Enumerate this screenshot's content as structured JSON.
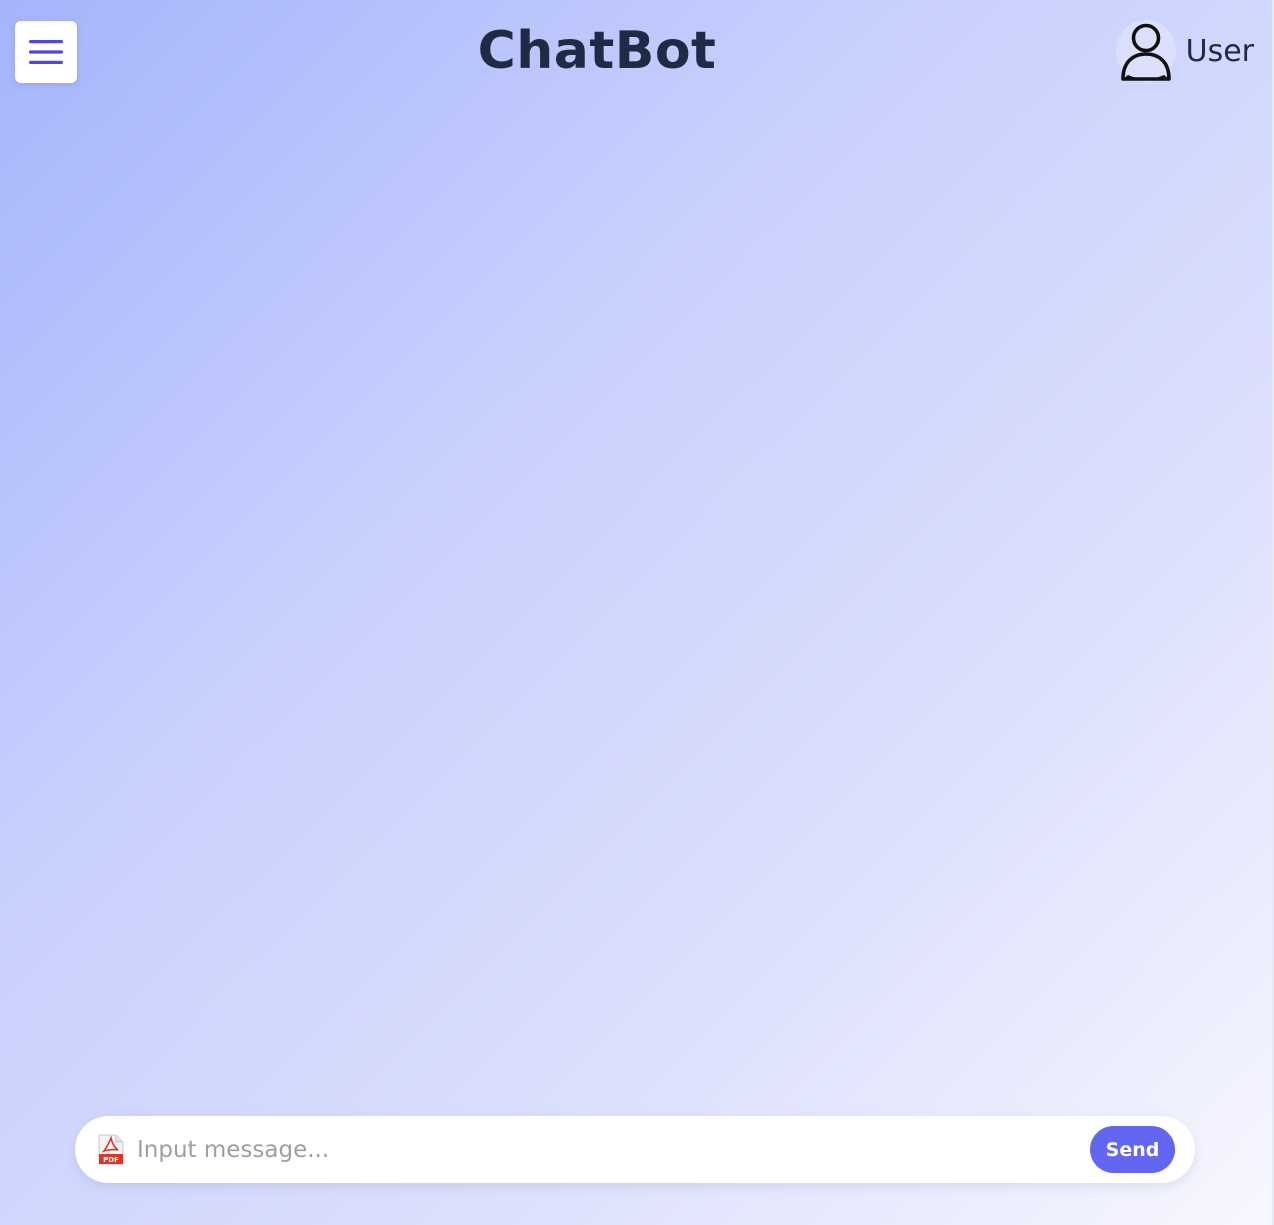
{
  "header": {
    "menu_icon": "hamburger-menu-icon",
    "title": "ChatBot",
    "user": {
      "avatar_icon": "user-avatar-icon",
      "name": "User"
    }
  },
  "composer": {
    "attach_icon": "pdf-file-icon",
    "placeholder": "Input message...",
    "value": "",
    "send_label": "Send"
  },
  "colors": {
    "accent": "#6366f1",
    "title_text": "#1f2a44",
    "background_start": "#a5b4fc",
    "background_end": "#f7f7ff"
  }
}
